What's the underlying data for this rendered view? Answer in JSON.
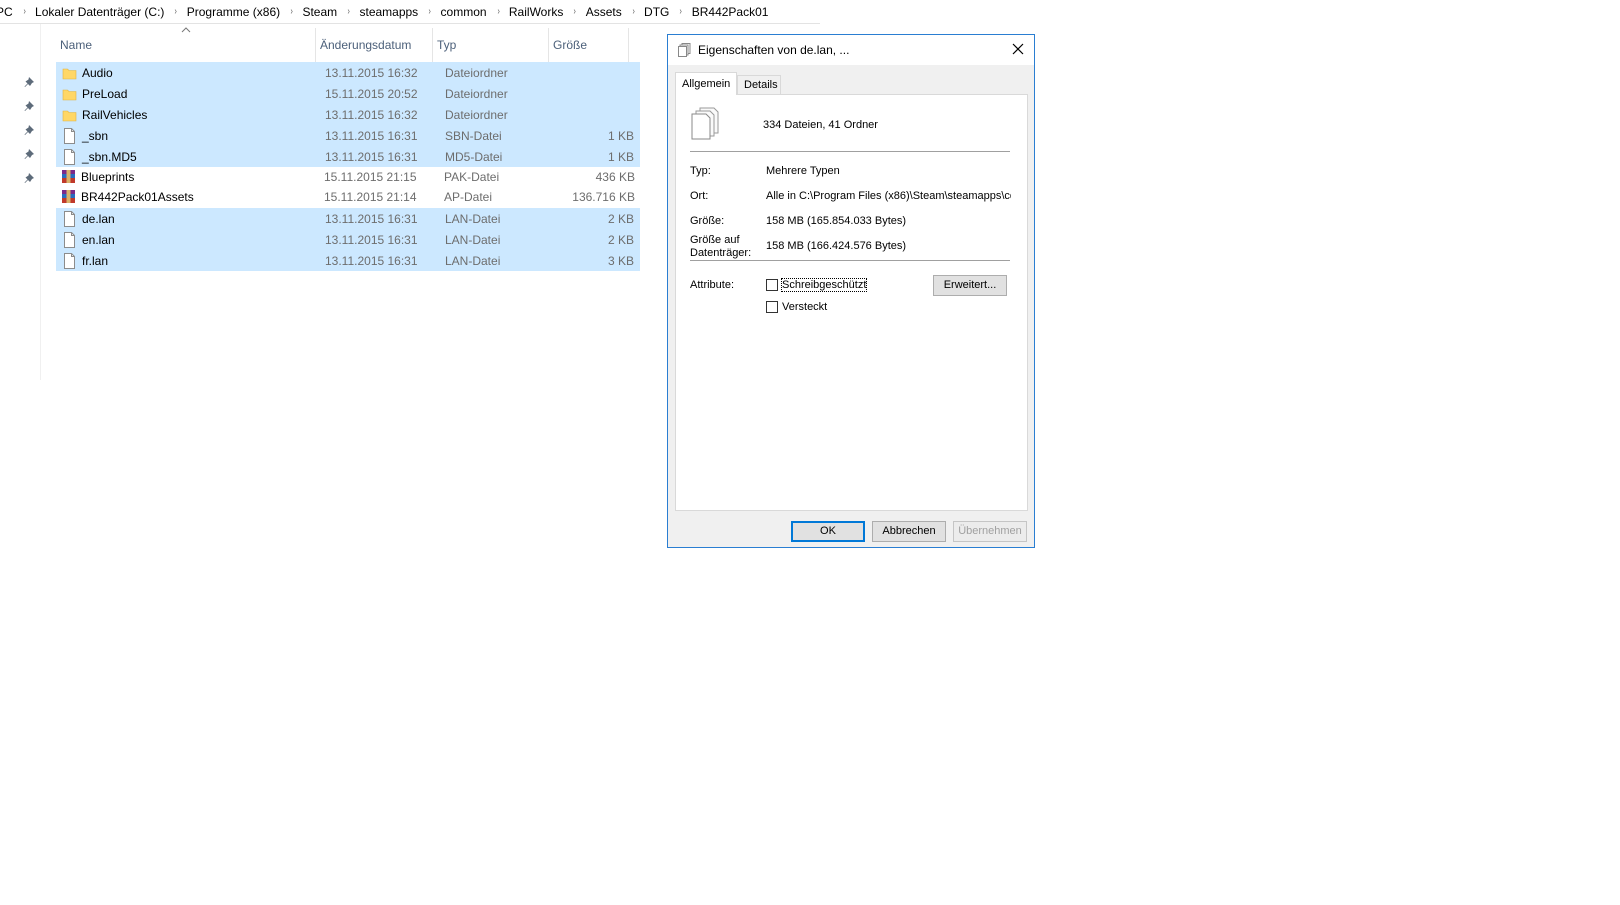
{
  "breadcrumb": [
    "PC",
    "Lokaler Datenträger (C:)",
    "Programme (x86)",
    "Steam",
    "steamapps",
    "common",
    "RailWorks",
    "Assets",
    "DTG",
    "BR442Pack01"
  ],
  "columns": {
    "name": "Name",
    "date": "Änderungsdatum",
    "type": "Typ",
    "size": "Größe"
  },
  "files": [
    {
      "name": "Audio",
      "date": "13.11.2015 16:32",
      "type": "Dateiordner",
      "size": "",
      "icon": "folder-icon",
      "selected": true
    },
    {
      "name": "PreLoad",
      "date": "15.11.2015 20:52",
      "type": "Dateiordner",
      "size": "",
      "icon": "folder-icon",
      "selected": true
    },
    {
      "name": "RailVehicles",
      "date": "13.11.2015 16:32",
      "type": "Dateiordner",
      "size": "",
      "icon": "folder-icon",
      "selected": true
    },
    {
      "name": "_sbn",
      "date": "13.11.2015 16:31",
      "type": "SBN-Datei",
      "size": "1 KB",
      "icon": "file-icon",
      "selected": true
    },
    {
      "name": "_sbn.MD5",
      "date": "13.11.2015 16:31",
      "type": "MD5-Datei",
      "size": "1 KB",
      "icon": "file-icon",
      "selected": true
    },
    {
      "name": "Blueprints",
      "date": "15.11.2015 21:15",
      "type": "PAK-Datei",
      "size": "436 KB",
      "icon": "archive-icon",
      "selected": false
    },
    {
      "name": "BR442Pack01Assets",
      "date": "15.11.2015 21:14",
      "type": "AP-Datei",
      "size": "136.716 KB",
      "icon": "archive-icon",
      "selected": false
    },
    {
      "name": "de.lan",
      "date": "13.11.2015 16:31",
      "type": "LAN-Datei",
      "size": "2 KB",
      "icon": "file-icon",
      "selected": true
    },
    {
      "name": "en.lan",
      "date": "13.11.2015 16:31",
      "type": "LAN-Datei",
      "size": "2 KB",
      "icon": "file-icon",
      "selected": true
    },
    {
      "name": "fr.lan",
      "date": "13.11.2015 16:31",
      "type": "LAN-Datei",
      "size": "3 KB",
      "icon": "file-icon",
      "selected": true
    }
  ],
  "dialog": {
    "title": "Eigenschaften von de.lan, ...",
    "tabs": [
      "Allgemein",
      "Details"
    ],
    "summary": "334 Dateien, 41 Ordner",
    "typ_label": "Typ:",
    "typ_value": "Mehrere Typen",
    "ort_label": "Ort:",
    "ort_value": "Alle in C:\\Program Files (x86)\\Steam\\steamapps\\co",
    "groesse_label": "Größe:",
    "groesse_value": "158 MB (165.854.033 Bytes)",
    "disk_label_line1": "Größe auf",
    "disk_label_line2": "Datenträger:",
    "disk_value": "158 MB (166.424.576 Bytes)",
    "attribute_label": "Attribute:",
    "readonly_label": "Schreibgeschützt",
    "hidden_label": "Versteckt",
    "advanced_button": "Erweitert...",
    "ok_button": "OK",
    "cancel_button": "Abbrechen",
    "apply_button": "Übernehmen"
  },
  "colors": {
    "selection": "#cce8ff",
    "dialog_border": "#2a7ed2",
    "folder": "#ffd766"
  }
}
